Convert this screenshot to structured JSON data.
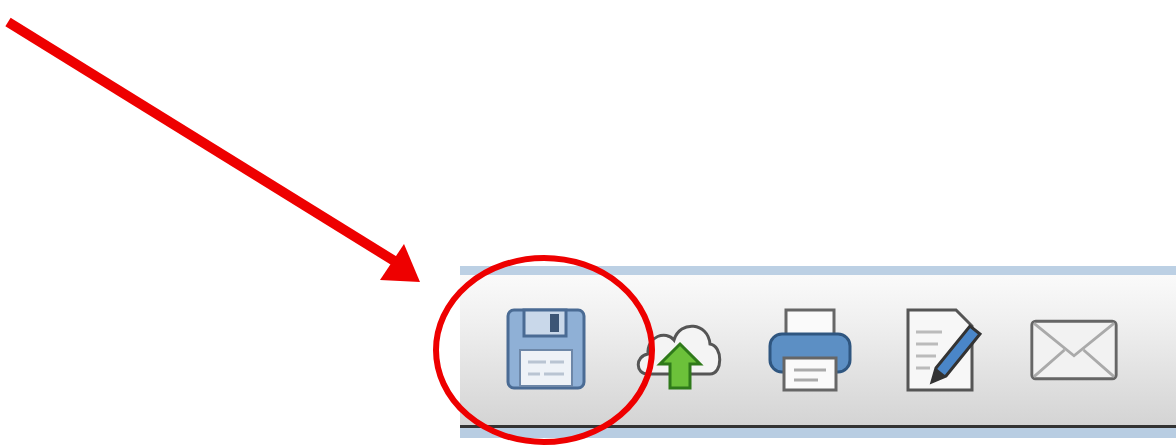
{
  "toolbar": {
    "buttons": [
      {
        "kind": "save"
      },
      {
        "kind": "upload"
      },
      {
        "kind": "print"
      },
      {
        "kind": "edit"
      },
      {
        "kind": "mail"
      }
    ]
  },
  "annotation": {
    "kind": "arrow-and-circle"
  }
}
